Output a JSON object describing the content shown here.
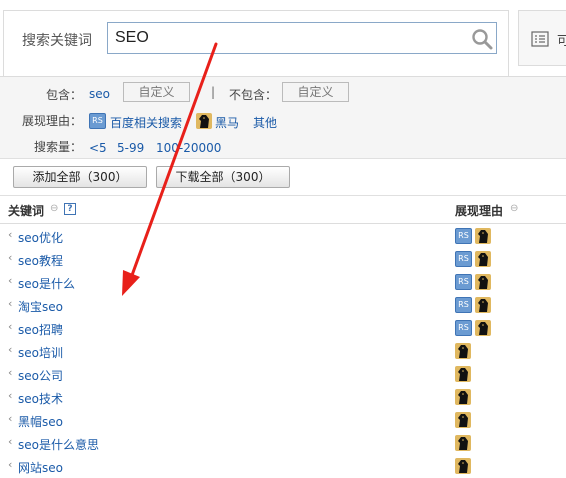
{
  "search": {
    "label": "搜索关键词",
    "value": "SEO"
  },
  "side_tab": {
    "label": "可"
  },
  "filters": {
    "include_label": "包含：",
    "include_value": "seo",
    "include_custom": "自定义",
    "separator": "|",
    "exclude_label": "不包含：",
    "exclude_custom": "自定义",
    "reason_label": "展现理由：",
    "reason_baidu": "百度相关搜索",
    "reason_horse": "黑马",
    "reason_other": "其他",
    "volume_label": "搜索量：",
    "volume_options": [
      "<5",
      "5-99",
      "100-20000"
    ]
  },
  "actions": {
    "add_all": "添加全部（300）",
    "download_all": "下载全部（300）"
  },
  "table": {
    "col_keyword": "关键词",
    "col_reason": "展现理由",
    "help": "?",
    "rows": [
      {
        "keyword": "seo优化",
        "rs": true
      },
      {
        "keyword": "seo教程",
        "rs": true
      },
      {
        "keyword": "seo是什么",
        "rs": true
      },
      {
        "keyword": "淘宝seo",
        "rs": true
      },
      {
        "keyword": "seo招聘",
        "rs": true
      },
      {
        "keyword": "seo培训",
        "rs": false
      },
      {
        "keyword": "seo公司",
        "rs": false
      },
      {
        "keyword": "seo技术",
        "rs": false
      },
      {
        "keyword": "黑帽seo",
        "rs": false
      },
      {
        "keyword": "seo是什么意思",
        "rs": false
      },
      {
        "keyword": "网站seo",
        "rs": false
      }
    ]
  },
  "badges": {
    "rs_text": "RS"
  },
  "colors": {
    "accent_link": "#1a5aa8",
    "arrow": "#e8201a",
    "rs_badge": "#6b9bd2",
    "horse_badge": "#e0b860"
  }
}
